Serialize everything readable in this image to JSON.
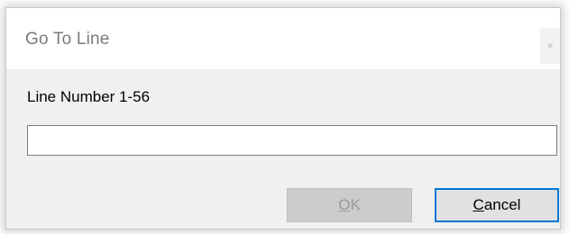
{
  "window": {
    "title": "Go To Line",
    "close_glyph": "×"
  },
  "form": {
    "label": "Line Number 1-56",
    "input_value": "",
    "input_placeholder": ""
  },
  "buttons": {
    "ok": {
      "accel": "O",
      "rest": "K",
      "enabled": false
    },
    "cancel": {
      "accel": "C",
      "rest": "ancel",
      "focused": true
    }
  },
  "colors": {
    "focus_border": "#0078d7",
    "disabled_text": "#9a9a9a",
    "title_text": "#7a7a7a"
  }
}
